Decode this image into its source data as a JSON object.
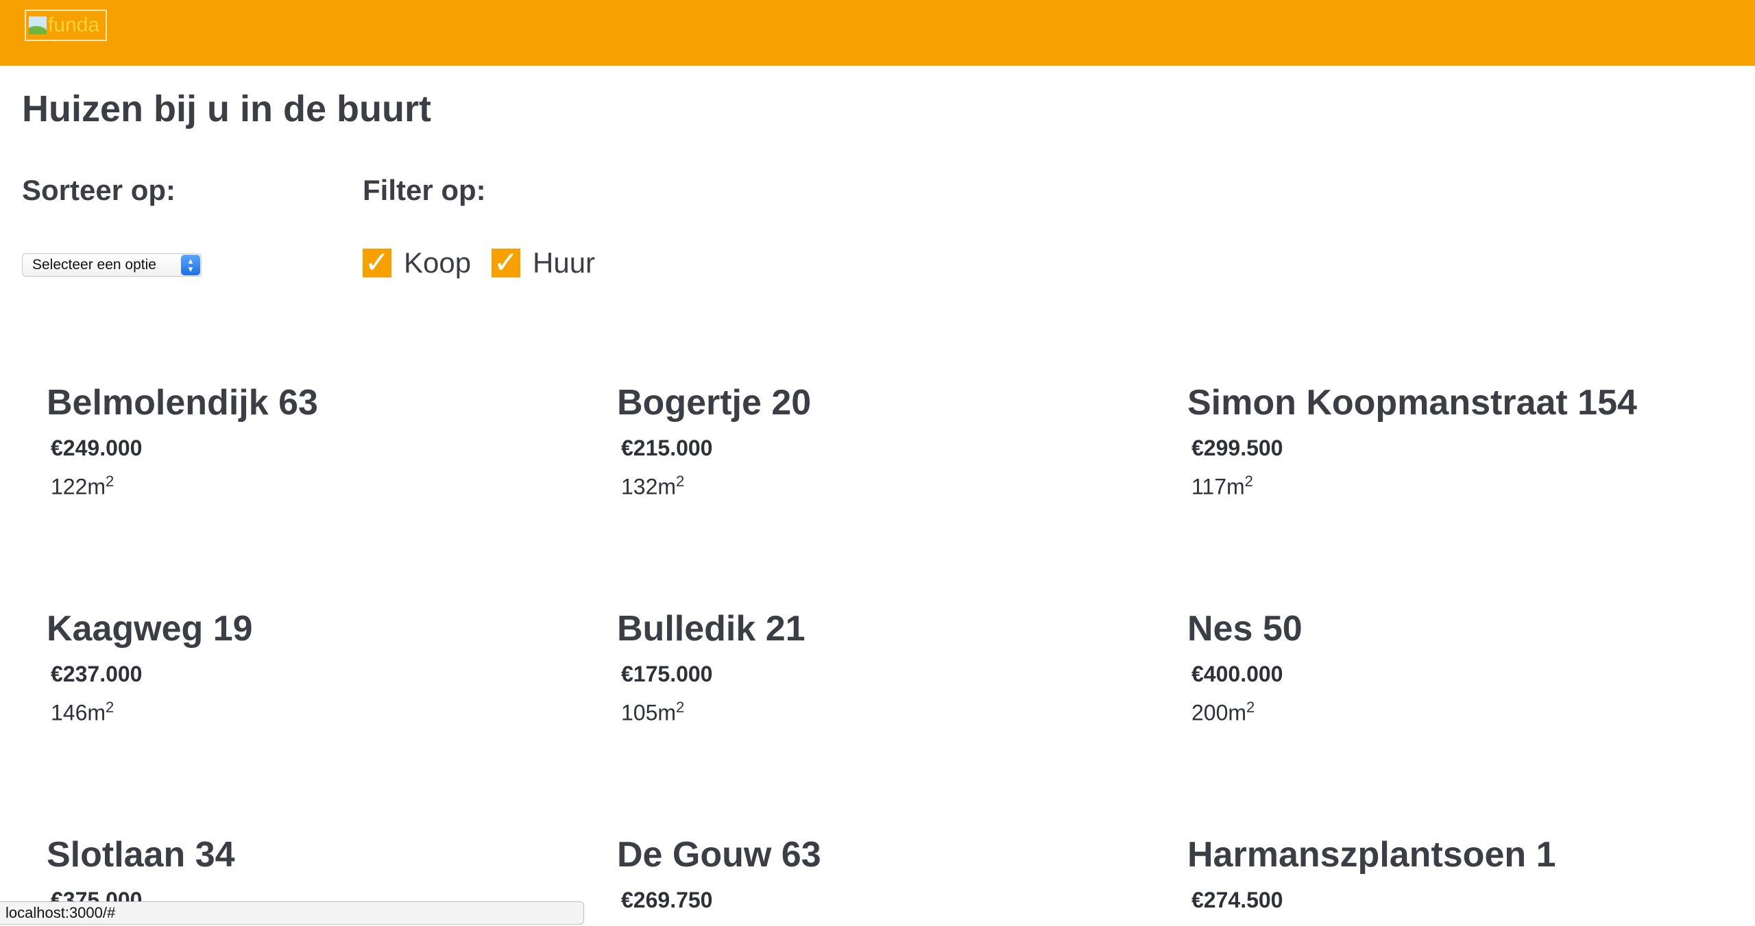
{
  "header": {
    "logo_alt": "funda",
    "brand_color": "#f7a100"
  },
  "page": {
    "title": "Huizen bij u in de buurt"
  },
  "sort": {
    "label": "Sorteer op:",
    "selected": "Selecteer een optie"
  },
  "filter": {
    "label": "Filter op:",
    "options": [
      {
        "label": "Koop",
        "checked": true
      },
      {
        "label": "Huur",
        "checked": true
      }
    ]
  },
  "listings": [
    {
      "street": "Belmolendijk 63",
      "price": "€249.000",
      "area": "122m",
      "unit_sup": "2"
    },
    {
      "street": "Bogertje 20",
      "price": "€215.000",
      "area": "132m",
      "unit_sup": "2"
    },
    {
      "street": "Simon Koopmanstraat 154",
      "price": "€299.500",
      "area": "117m",
      "unit_sup": "2"
    },
    {
      "street": "Kaagweg 19",
      "price": "€237.000",
      "area": "146m",
      "unit_sup": "2"
    },
    {
      "street": "Bulledik 21",
      "price": "€175.000",
      "area": "105m",
      "unit_sup": "2"
    },
    {
      "street": "Nes 50",
      "price": "€400.000",
      "area": "200m",
      "unit_sup": "2"
    },
    {
      "street": "Slotlaan 34",
      "price": "€375.000",
      "area": "",
      "unit_sup": ""
    },
    {
      "street": "De Gouw 63",
      "price": "€269.750",
      "area": "",
      "unit_sup": ""
    },
    {
      "street": "Harmanszplantsoen 1",
      "price": "€274.500",
      "area": "",
      "unit_sup": ""
    }
  ],
  "statusbar": {
    "url": "localhost:3000/#"
  }
}
